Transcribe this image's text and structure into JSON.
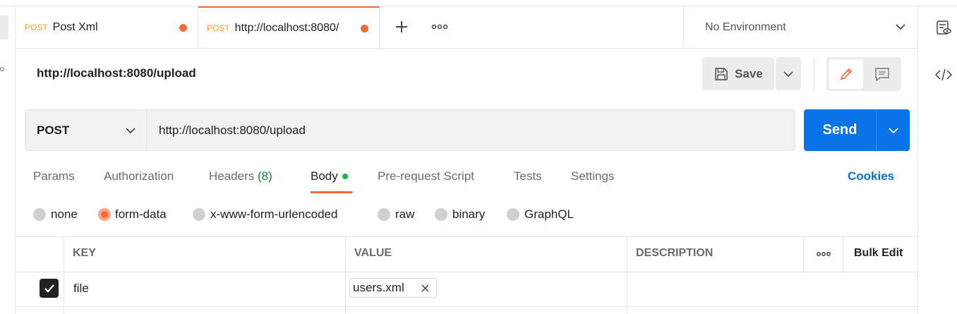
{
  "tabs": [
    {
      "method": "POST",
      "title": "Post Xml"
    },
    {
      "method": "POST",
      "title": "http://localhost:8080/"
    }
  ],
  "environment": {
    "label": "No Environment"
  },
  "request": {
    "title": "http://localhost:8080/upload",
    "method": "POST",
    "url": "http://localhost:8080/upload"
  },
  "toolbar": {
    "save_label": "Save",
    "send_label": "Send"
  },
  "subtabs": {
    "params": "Params",
    "authorization": "Authorization",
    "headers": "Headers",
    "headers_count": "(8)",
    "body": "Body",
    "prerequest": "Pre-request Script",
    "tests": "Tests",
    "settings": "Settings",
    "cookies": "Cookies"
  },
  "body_types": {
    "none": "none",
    "form_data": "form-data",
    "urlencoded": "x-www-form-urlencoded",
    "raw": "raw",
    "binary": "binary",
    "graphql": "GraphQL",
    "selected": "form-data"
  },
  "table": {
    "columns": {
      "key": "KEY",
      "value": "VALUE",
      "description": "DESCRIPTION"
    },
    "bulk_edit": "Bulk Edit",
    "rows": [
      {
        "checked": true,
        "key": "file",
        "value_file": "users.xml",
        "description": ""
      }
    ]
  },
  "colors": {
    "accent": "#f26b3a",
    "send": "#0a73e8",
    "link": "#0a6fd1",
    "status_dot": "#0cbb52"
  }
}
